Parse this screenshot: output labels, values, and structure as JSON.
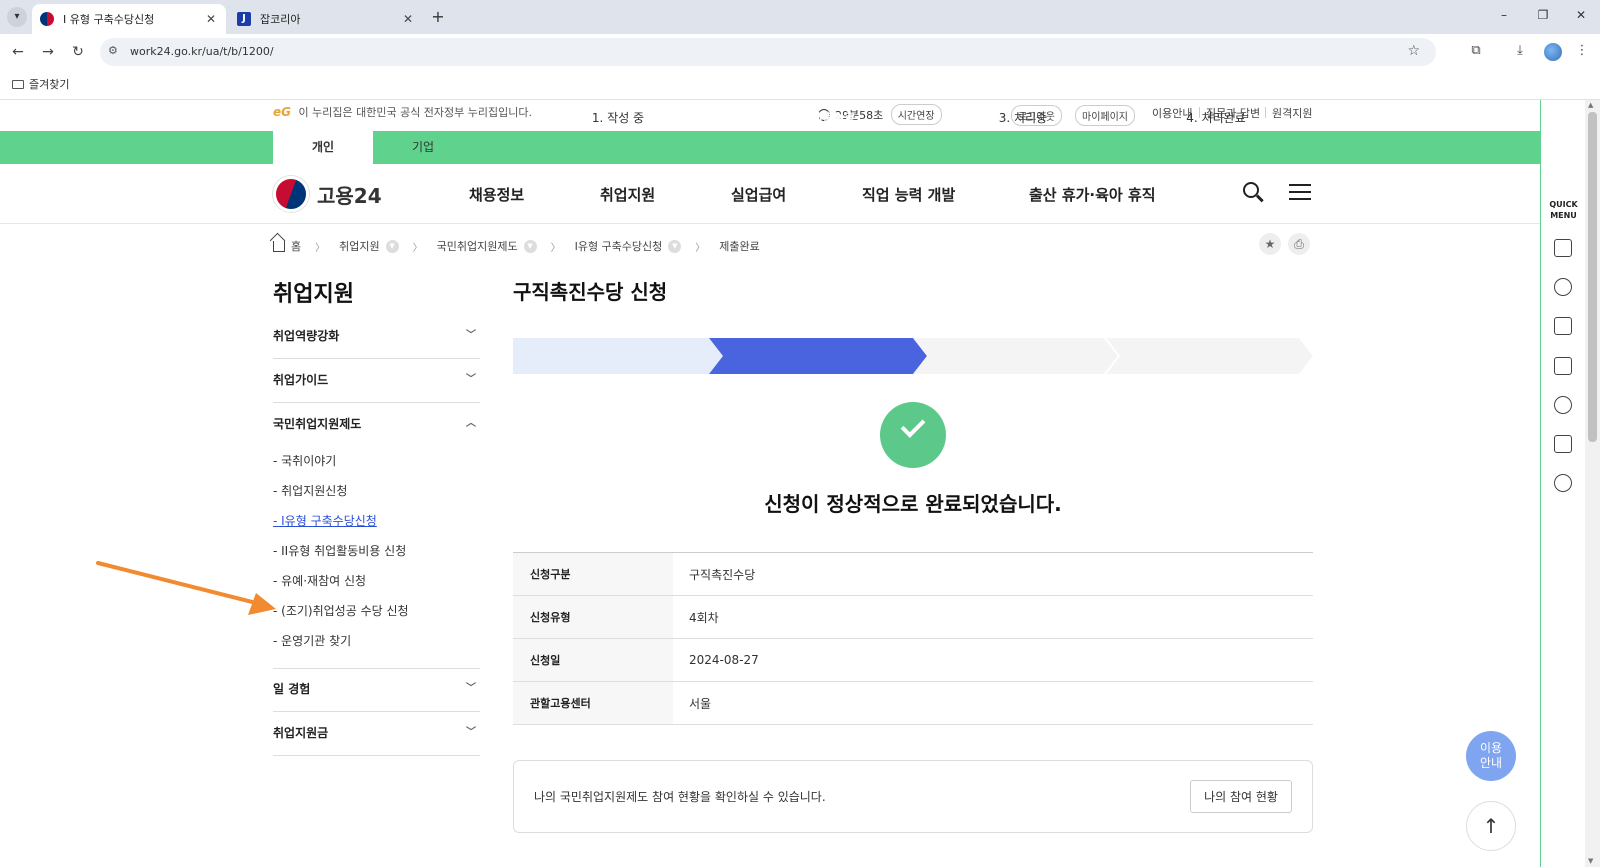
{
  "browser": {
    "tabs": [
      {
        "title": "I 유형 구축수당신청",
        "active": true
      },
      {
        "title": "잡코리아",
        "active": false,
        "favicon_letter": "J"
      }
    ],
    "url": "work24.go.kr/ua/t/b/1200/",
    "bookmarks_label": "즐겨찾기"
  },
  "gov_notice": "이 누리집은 대한민국 공식 전자정부 누리집입니다.",
  "gov_logo_text": "eG",
  "session": {
    "time_left": "29분58초",
    "extend_label": "시간연장"
  },
  "utility_links": {
    "logout": "로그아웃",
    "mypage": "마이페이지",
    "guide": "이용안내",
    "qna": "질문과 답변",
    "remote": "원격지원"
  },
  "audience_tabs": {
    "personal": "개인",
    "business": "기업"
  },
  "site": {
    "name": "고용24"
  },
  "main_menu": [
    "채용정보",
    "취업지원",
    "실업급여",
    "직업 능력 개발",
    "출산 휴가·육아 휴직"
  ],
  "breadcrumb": {
    "home": "홈",
    "items": [
      "취업지원",
      "국민취업지원제도",
      "I유형 구축수당신청",
      "제출완료"
    ]
  },
  "sidebar": {
    "title": "취업지원",
    "groups": [
      {
        "label": "취업역량강화"
      },
      {
        "label": "취업가이드"
      },
      {
        "label": "국민취업지원제도",
        "items": [
          "- 국취이야기",
          "- 취업지원신청",
          "- I유형 구축수당신청",
          "- II유형 취업활동비용 신청",
          "- 유예·재참여 신청",
          "- (조기)취업성공 수당 신청",
          "- 운영기관 찾기"
        ]
      },
      {
        "label": "일 경험"
      },
      {
        "label": "취업지원금"
      }
    ]
  },
  "content": {
    "title": "구직촉진수당 신청",
    "steps": [
      "1. 작성 중",
      "2. 제출완료",
      "3. 처리중",
      "4. 처리완료"
    ],
    "active_step": 2,
    "completion_message": "신청이 정상적으로 완료되었습니다.",
    "info_rows": [
      {
        "label": "신청구분",
        "value": "구직촉진수당"
      },
      {
        "label": "신청유형",
        "value": "4회차"
      },
      {
        "label": "신청일",
        "value": "2024-08-27"
      },
      {
        "label": "관할고용센터",
        "value": "서울"
      }
    ],
    "notice": {
      "text": "나의 국민취업지원제도 참여 현황을 확인하실 수 있습니다.",
      "button": "나의 참여 현황"
    }
  },
  "quick_menu": {
    "label_line1": "QUICK",
    "label_line2": "MENU"
  },
  "help_fab": {
    "line1": "이용",
    "line2": "안내"
  },
  "colors": {
    "green": "#5fd38d",
    "step_active": "#4a63de",
    "step_done": "#e4edf9",
    "check": "#5cc98a",
    "link": "#2a4ed8",
    "arrow": "#f28a30"
  }
}
